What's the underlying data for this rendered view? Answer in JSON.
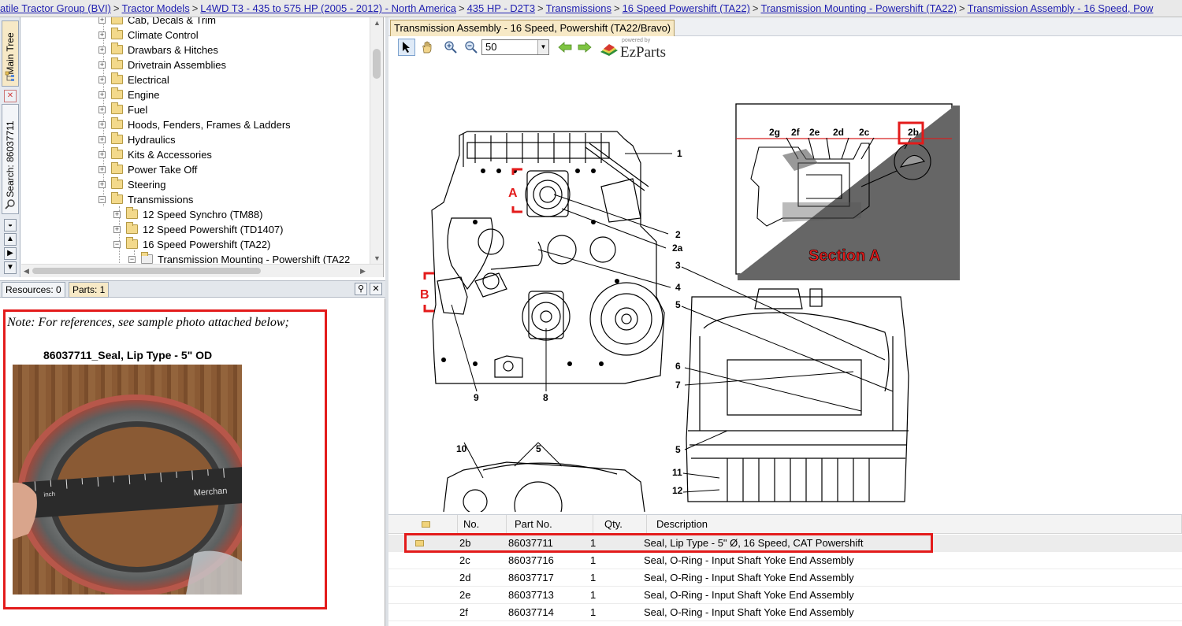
{
  "breadcrumb": [
    "atile Tractor Group (BVI)",
    "Tractor Models",
    "L4WD T3 - 435 to 575 HP (2005 - 2012) - North America",
    "435 HP - D2T3",
    "Transmissions",
    "16 Speed Powershift (TA22)",
    "Transmission Mounting - Powershift (TA22)",
    "Transmission Assembly - 16 Speed, Pow"
  ],
  "breadcrumb_sep": ">",
  "side_tabs": {
    "main_tree": "Main Tree",
    "search": "Search: 86037711"
  },
  "tree": {
    "items": [
      {
        "label": "Cab, Decals & Trim",
        "level": 0
      },
      {
        "label": "Climate Control",
        "level": 0
      },
      {
        "label": "Drawbars & Hitches",
        "level": 0
      },
      {
        "label": "Drivetrain Assemblies",
        "level": 0
      },
      {
        "label": "Electrical",
        "level": 0
      },
      {
        "label": "Engine",
        "level": 0
      },
      {
        "label": "Fuel",
        "level": 0
      },
      {
        "label": "Hoods, Fenders, Frames & Ladders",
        "level": 0
      },
      {
        "label": "Hydraulics",
        "level": 0
      },
      {
        "label": "Kits & Accessories",
        "level": 0
      },
      {
        "label": "Power Take Off",
        "level": 0
      },
      {
        "label": "Steering",
        "level": 0
      },
      {
        "label": "Transmissions",
        "level": 0
      },
      {
        "label": "12 Speed Synchro (TM88)",
        "level": 1
      },
      {
        "label": "12 Speed Powershift (TD1407)",
        "level": 1
      },
      {
        "label": "16 Speed Powershift (TA22)",
        "level": 1
      },
      {
        "label": "Transmission Mounting - Powershift (TA22",
        "level": 2
      }
    ]
  },
  "panel_tabs": {
    "resources": "Resources: 0",
    "parts": "Parts: 1"
  },
  "notes": {
    "note": "Note: For references, see sample photo attached below;",
    "photo_caption": "86037711_Seal, Lip Type - 5\" OD"
  },
  "document": {
    "tab_title": "Transmission Assembly - 16 Speed, Powershift (TA22/Bravo)",
    "zoom": "50",
    "brand_small": "powered by",
    "brand": "EzParts"
  },
  "diagram": {
    "section_a_title": "Section A",
    "section_labels": [
      "2g",
      "2f",
      "2e",
      "2d",
      "2c",
      "2b"
    ],
    "callouts": [
      "1",
      "2",
      "2a",
      "3",
      "4",
      "5",
      "6",
      "7",
      "5",
      "11",
      "12",
      "9",
      "8",
      "10",
      "5"
    ],
    "markers": [
      "A",
      "B"
    ]
  },
  "parts": {
    "headers": {
      "no": "No.",
      "part_no": "Part No.",
      "qty": "Qty.",
      "description": "Description"
    },
    "rows": [
      {
        "no": "2b",
        "part_no": "86037711",
        "qty": "1",
        "description": "Seal, Lip Type - 5\" Ø, 16 Speed, CAT Powershift"
      },
      {
        "no": "2c",
        "part_no": "86037716",
        "qty": "1",
        "description": "Seal, O-Ring - Input Shaft Yoke End Assembly"
      },
      {
        "no": "2d",
        "part_no": "86037717",
        "qty": "1",
        "description": "Seal, O-Ring - Input Shaft Yoke End Assembly"
      },
      {
        "no": "2e",
        "part_no": "86037713",
        "qty": "1",
        "description": "Seal, O-Ring - Input Shaft Yoke End Assembly"
      },
      {
        "no": "2f",
        "part_no": "86037714",
        "qty": "1",
        "description": "Seal, O-Ring - Input Shaft Yoke End Assembly"
      }
    ]
  },
  "colors": {
    "highlight": "#e31b1b",
    "link": "#1f1fb0",
    "tab_active": "#f7e9c6"
  },
  "ruler_text": {
    "brand": "Merchan",
    "unit": "inch"
  }
}
